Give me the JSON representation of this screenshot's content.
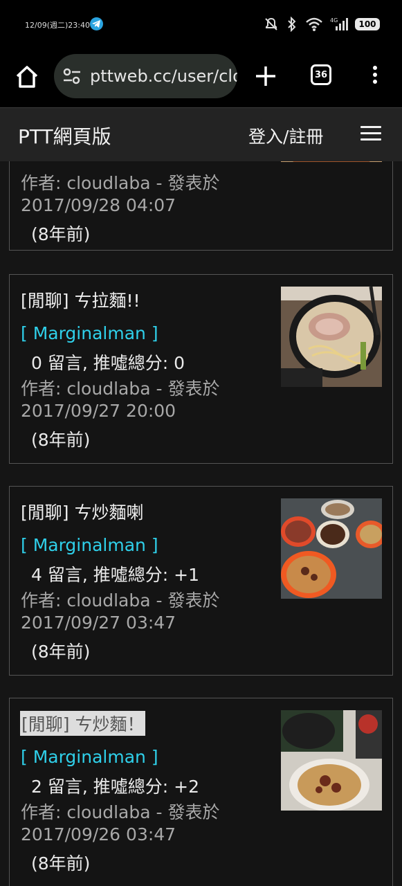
{
  "status_bar": {
    "datetime": "12/09(週二)23:40",
    "battery": "100"
  },
  "browser": {
    "url": "pttweb.cc/user/cloudlaba",
    "tab_count": "36"
  },
  "site": {
    "title": "PTT網頁版",
    "login_label": "登入/註冊"
  },
  "posts": [
    {
      "author_line": "作者: cloudlaba - 發表於",
      "date": "2017/09/28 04:07",
      "ago": "(8年前)"
    },
    {
      "title": "[閒聊] ㄘ拉麵!!",
      "board": "[ Marginalman ]",
      "stats": "0 留言, 推噓總分: 0",
      "author_line": "作者: cloudlaba - 發表於",
      "date": "2017/09/27 20:00",
      "ago": "(8年前)"
    },
    {
      "title": "[閒聊] ㄘ炒麵喇",
      "board": "[ Marginalman ]",
      "stats": "4 留言, 推噓總分: +1",
      "author_line": "作者: cloudlaba - 發表於",
      "date": "2017/09/27 03:47",
      "ago": "(8年前)"
    },
    {
      "title": "[閒聊] ㄘ炒麵！",
      "board": "[ Marginalman ]",
      "stats": "2 留言, 推噓總分: +2",
      "author_line": "作者: cloudlaba - 發表於",
      "date": "2017/09/26 03:47",
      "ago": "(8年前)"
    }
  ],
  "colors": {
    "board_link": "#2fd0ea",
    "background": "#151515",
    "header": "#232323"
  }
}
